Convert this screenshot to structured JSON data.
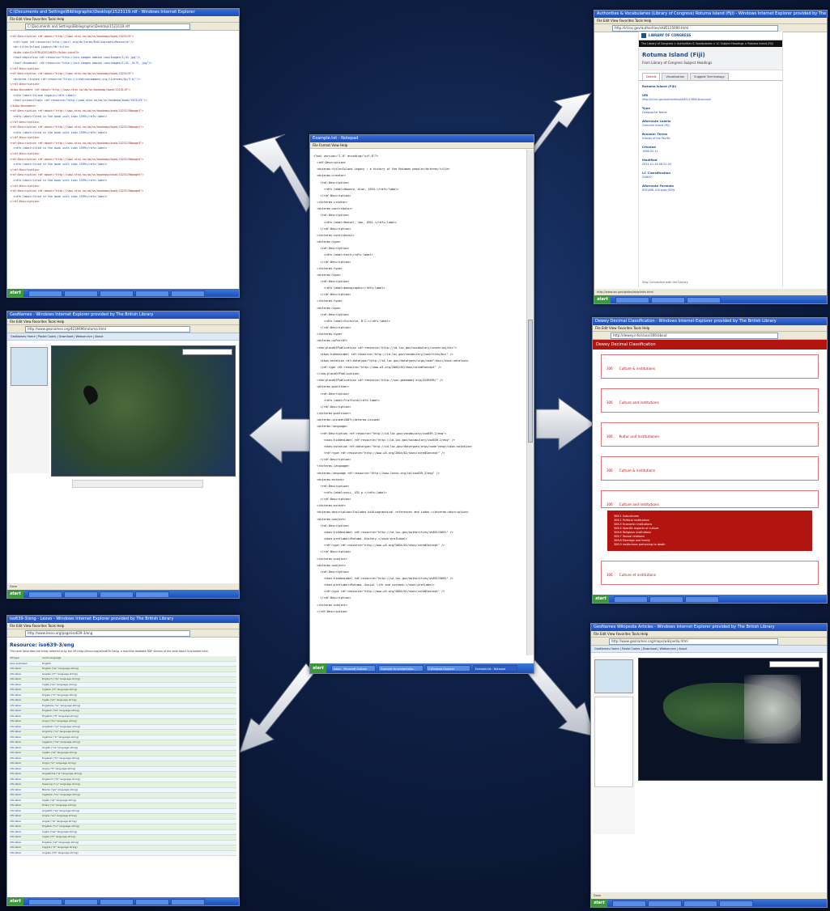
{
  "center": {
    "title": "Example.txt - Notepad",
    "menu": "File  Format  View  Help",
    "lines": [
      "<?xml version=\"1.0\" encoding=\"utf-8\"?>",
      "  <rdf:Description>",
      "  <dcterms:title>Island Legacy : a history of the Rotuman people</dcterms:title>",
      "  <dcterms:creator>",
      "    <rdf:Description>",
      "      <rdfs:label>Howard, Alan, 1934-</rdfs:label>",
      "    </rdf:Description>",
      "  </dcterms:creator>",
      "  <dcterms:contributor>",
      "    <rdf:Description>",
      "      <rdfs:label>Rensel, Jan, 1951-</rdfs:label>",
      "    </rdf:Description>",
      "  </dcterms:contributor>",
      "  <dcterms:type>",
      "    <rdf:Description>",
      "      <rdfs:label>text</rdfs:label>",
      "    </rdf:Description>",
      "  </dcterms:type>",
      "  <dcterms:type>",
      "    <rdf:Description>",
      "      <rdfs:label>monographic</rdfs:label>",
      "    </rdf:Description>",
      "  </dcterms:type>",
      "  <dcterms:type>",
      "    <rdf:Description>",
      "      <rdfs:label>Victoria, B.C.</rdfs:label>",
      "    </rdf:Description>",
      "  </dcterms:type>",
      "  <dcterms:isPartOf>",
      "  <rda:placeOfPublication rdf:resource=\"http://id.loc.gov/vocabulary/countries/bcc\">",
      "    <skos:hiddenLabel rdf:resource=\"http://id.loc.gov/vocabulary/countries/bcc\" />",
      "    <skos:notation rdf:datatype=\"http://id.loc.gov/datatypes/orgs/code\">bcc</skos:notation>",
      "    <rdf:type rdf:resource=\"http://www.w3.org/2004/02/skos/core#Concept\" />",
      "  </rda:placeOfPublication>",
      "  <rda:placeOfPublication rdf:resource=\"http://sws.geonames.org/4239496/\" />",
      "  <dcterms:publisher>",
      "    <rdf:Description>",
      "      <rdfs:label>Trafford</rdfs:label>",
      "    </rdf:Description>",
      "  </dcterms:publisher>",
      "  <dcterms:issued>2007</dcterms:issued>",
      "  <dcterms:language>",
      "    <rdf:Description rdf:resource=\"http://id.loc.gov/vocabulary/iso639-2/eng\">",
      "      <skos:hiddenLabel rdf:resource=\"http://id.loc.gov/vocabulary/iso639-2/eng\" />",
      "      <skos:notation rdf:datatype=\"http://id.loc.gov/datatypes/orgs/code\">eng</skos:notation>",
      "      <rdf:type rdf:resource=\"http://www.w3.org/2004/02/skos/core#Concept\" />",
      "    </rdf:Description>",
      "  </dcterms:language>",
      "  <dcterms:language rdf:resource=\"http://www.lexvo.org/id/iso639-3/eng\" />",
      "  <dcterms:extent>",
      "    <rdf:Description>",
      "      <rdfs:label>xxvi, 432 p.</rdfs:label>",
      "    </rdf:Description>",
      "  </dcterms:extent>",
      "  <dcterms:description>Includes bibliographical references and index.</dcterms:description>",
      "  <dcterms:subject>",
      "    <rdf:Description>",
      "      <skos:hiddenLabel rdf:resource=\"http://id.loc.gov/authorities/sh85115691\" />",
      "      <skos:prefLabel>Rotuma--History.</skos:prefLabel>",
      "      <rdf:type rdf:resource=\"http://www.w3.org/2004/02/skos/core#Concept\" />",
      "    </rdf:Description>",
      "  </dcterms:subject>",
      "  <dcterms:subject>",
      "    <rdf:Description>",
      "      <skos:hiddenLabel rdf:resource=\"http://id.loc.gov/authorities/sh85115692\" />",
      "      <skos:prefLabel>Rotuma--Social life and customs.</skos:prefLabel>",
      "      <rdf:type rdf:resource=\"http://www.w3.org/2004/02/skos/core#Concept\" />",
      "    </rdf:Description>",
      "  </dcterms:subject>",
      "  </rdf:Description>"
    ],
    "taskbar": [
      "Inbox - Microsoft Outlook",
      "Example for presentatio...",
      "3 Windows Explorer",
      "Example.txt - Notepad"
    ]
  },
  "top_left": {
    "title": "C:\\Documents and Settings\\Bibliographic\\Desktop\\1523119.rdf - Windows Internet Explorer",
    "menu": "File  Edit  View  Favorites  Tools  Help",
    "address": "C:\\Documents and Settings\\Bibliographic\\Desktop\\1523119.rdf",
    "lines": [
      "<rdf:Description rdf:about=\"http://www.ntnu.no/ub/sn/bookmap/book/1523119\">",
      "  <rdf:type rdf:resource=\"http://purl.org/dc/terms/BibliographicResource\"/>",
      "  <dc:title>Island Legacy</dc:title>",
      "  <bibo:isbn13>9781425124632</bibo:isbn13>",
      "  <foaf:depiction rdf:resource=\"http://ecx.images-amazon.com/images/I/41.jpg\"/>",
      "  <foaf:thumbnail rdf:resource=\"http://ecx.images-amazon.com/images/I/41._SL75_.jpg\"/>",
      "</rdf:Description>",
      "<rdf:Description rdf:about=\"http://www.ntnu.no/ub/sn/bookmap/book/1523119\">",
      "  <dcterms:license rdf:resource=\"http://creativecommons.org/licenses/by/3.0/\"/>",
      "</rdf:Description>",
      "<bibo:Document rdf:about=\"http://www.ntnu.no/ub/sn/bookmap/book/1523119\">",
      "  <rdfs:label>Island Legacy</rdfs:label>",
      "  <foaf:primaryTopic rdf:resource=\"http://www.ntnu.no/ub/sn/bookmap/book/1523119\"/>",
      "</bibo:Document>",
      "<rdf:Description rdf:about=\"http://www.ntnu.no/ub/sn/bookmap/book/1523119#page1\">",
      "  <rdfs:label>Cited in the book with isbn 1599</rdfs:label>",
      "</rdf:Description>",
      "<rdf:Description rdf:about=\"http://www.ntnu.no/ub/sn/bookmap/book/1523119#page2\">",
      "  <rdfs:label>Cited in the book with isbn 1599</rdfs:label>",
      "</rdf:Description>",
      "<rdf:Description rdf:about=\"http://www.ntnu.no/ub/sn/bookmap/book/1523119#page3\">",
      "  <rdfs:label>Cited in the book with isbn 1599</rdfs:label>",
      "</rdf:Description>",
      "<rdf:Description rdf:about=\"http://www.ntnu.no/ub/sn/bookmap/book/1523119#page4\">",
      "  <rdfs:label>Cited in the book with isbn 1599</rdfs:label>",
      "</rdf:Description>",
      "<rdf:Description rdf:about=\"http://www.ntnu.no/ub/sn/bookmap/book/1523119#page5\">",
      "  <rdfs:label>Cited in the book with isbn 1599</rdfs:label>",
      "</rdf:Description>",
      "<rdf:Description rdf:about=\"http://www.ntnu.no/ub/sn/bookmap/book/1523119#page6\">",
      "  <rdfs:label>Cited in the book with isbn 1599</rdfs:label>",
      "</rdf:Description>"
    ]
  },
  "top_right": {
    "title": "Authorities & Vocabularies (Library of Congress) Rotuma Island (Fiji) - Windows Internet Explorer provided by The British Library",
    "menu": "File  Edit  View  Favorites  Tools  Help",
    "address": "http://id.loc.gov/authorities/sh85115690.html",
    "site_name": "LIBRARY OF CONGRESS",
    "breadcrumb": "The Library of Congress > Authorities & Vocabularies > LC Subject Headings > Rotuma Island (Fiji)",
    "heading": "Rotuma Island (Fiji)",
    "subheading": "From Library of Congress Subject Headings",
    "tabs": [
      "Details",
      "Visualization",
      "Suggest Terminology"
    ],
    "fields": [
      {
        "label": "Rotuma Island (Fiji)",
        "value": ""
      },
      {
        "label": "URI",
        "value": "http://id.loc.gov/authorities/sh85115690#concept"
      },
      {
        "label": "Type",
        "value": "Geographic Name"
      },
      {
        "label": "Alternate Labels",
        "value": "Grenville Island (Fiji)"
      },
      {
        "label": "Broader Terms",
        "value": "Islands of the Pacific"
      },
      {
        "label": "Created",
        "value": "1986-02-11"
      },
      {
        "label": "Modified",
        "value": "2011-01-26 08:52:03"
      },
      {
        "label": "LC Classification",
        "value": "DU600"
      },
      {
        "label": "Alternate Formats",
        "value": "RDF/XML  N-Triples  JSON"
      }
    ],
    "footer": "Stay Connected with the Library",
    "status": "http://www.loc.gov/global/skiplinks.html"
  },
  "mid_left": {
    "title": "GeoNames - Windows Internet Explorer provided by The British Library",
    "menu": "File  Edit  View  Favorites  Tools  Help",
    "address": "http://www.geonames.org/4239496/rotuma.html",
    "nav": "GeoNames Home | Postal Codes | Download | Webservice | About",
    "status": "Done"
  },
  "mid_right": {
    "title": "Dewey Decimal Classification - Windows Internet Explorer provided by The British Library",
    "menu": "File  Edit  View  Favorites  Tools  Help",
    "address": "http://dewey.info/class/306/about",
    "banner": "Dewey Decimal Classification",
    "entries": [
      {
        "code": "306",
        "label": "Culture & institutions"
      },
      {
        "code": "306",
        "label": "Culture and institutions"
      },
      {
        "code": "306",
        "label": "Kultur und Institutionen"
      },
      {
        "code": "306",
        "label": "Culture & institutions"
      },
      {
        "code": "306",
        "label": "Culture and institutions"
      },
      {
        "code": "306",
        "label": "Culture et institutions"
      }
    ],
    "subclasses": [
      "306.1  Subcultures",
      "306.2  Political institutions",
      "306.3  Economic institutions",
      "306.4  Specific aspects of culture",
      "306.6  Religious institutions",
      "306.7  Sexual relations",
      "306.8  Marriage and family",
      "306.9  Institutions pertaining to death"
    ]
  },
  "bottom_left": {
    "title": "iso639-3/eng - Lexvo - Windows Internet Explorer provided by The British Library",
    "menu": "File  Edit  View  Favorites  Tools  Help",
    "address": "http://www.lexvo.org/page/iso639-3/eng",
    "heading": "Resource: iso639-3/eng",
    "intro": "This term describes the entity referred to by the URI http://lexvo.org/id/iso639-3/eng, a machine-readable RDF version of the view about is provided here.",
    "rows": [
      [
        "rdf:type",
        "lvont:Language"
      ],
      [
        "skos:prefLabel",
        "English"
      ],
      [
        "rdfs:label",
        "English (\"en\" language string)"
      ],
      [
        "rdfs:label",
        "Anglais (\"fr\" language string)"
      ],
      [
        "rdfs:label",
        "Englisch (\"de\" language string)"
      ],
      [
        "rdfs:label",
        "Inglés (\"es\" language string)"
      ],
      [
        "rdfs:label",
        "Inglese (\"it\" language string)"
      ],
      [
        "rdfs:label",
        "Engels (\"nl\" language string)"
      ],
      [
        "rdfs:label",
        "Inglês (\"pt\" language string)"
      ],
      [
        "rdfs:label",
        "Engelska (\"sv\" language string)"
      ],
      [
        "rdfs:label",
        "Engelsk (\"da\" language string)"
      ],
      [
        "rdfs:label",
        "Englanti (\"fi\" language string)"
      ],
      [
        "rdfs:label",
        "Angol (\"hu\" language string)"
      ],
      [
        "rdfs:label",
        "Angielski (\"pl\" language string)"
      ],
      [
        "rdfs:label",
        "Anglický (\"cs\" language string)"
      ],
      [
        "rdfs:label",
        "İngilizce (\"tr\" language string)"
      ],
      [
        "rdfs:label",
        "Inggeris (\"ms\" language string)"
      ],
      [
        "rdfs:label",
        "Anglès (\"ca\" language string)"
      ],
      [
        "rdfs:label",
        "Ingalls (\"et\" language string)"
      ],
      [
        "rdfs:label",
        "Engleski (\"hr\" language string)"
      ],
      [
        "rdfs:label",
        "Angļu (\"lv\" language string)"
      ],
      [
        "rdfs:label",
        "Anglų (\"lt\" language string)"
      ],
      [
        "rdfs:label",
        "Angleščina (\"sl\" language string)"
      ],
      [
        "rdfs:label",
        "Englesch (\"lb\" language string)"
      ],
      [
        "rdfs:label",
        "Saesneg (\"cy\" language string)"
      ],
      [
        "rdfs:label",
        "Béarla (\"ga\" language string)"
      ],
      [
        "rdfs:label",
        "Ingelesa (\"eu\" language string)"
      ],
      [
        "rdfs:label",
        "Inglés (\"gl\" language string)"
      ],
      [
        "rdfs:label",
        "Enska (\"is\" language string)"
      ],
      [
        "rdfs:label",
        "Anglisht (\"sq\" language string)"
      ],
      [
        "rdfs:label",
        "Angla (\"eo\" language string)"
      ],
      [
        "rdfs:label",
        "Anglia (\"la\" language string)"
      ],
      [
        "rdfs:label",
        "Englesk (\"no\" language string)"
      ],
      [
        "rdfs:label",
        "Inglisi (\"sw\" language string)"
      ],
      [
        "rdfs:label",
        "Ingles (\"tl\" language string)"
      ],
      [
        "rdfs:label",
        "Engelse (\"af\" language string)"
      ],
      [
        "rdfs:label",
        "Inggris (\"id\" language string)"
      ],
      [
        "rdfs:label",
        "Anglais (\"ht\" language string)"
      ]
    ]
  },
  "bottom_right": {
    "title": "GeoNames Wikipedia Articles - Windows Internet Explorer provided by The British Library",
    "menu": "File  Edit  View  Favorites  Tools  Help",
    "address": "http://www.geonames.org/maps/wikipedia.html",
    "nav": "GeoNames Home | Postal Codes | Download | Webservice | About",
    "status": "Done"
  },
  "colors": {
    "background": "#0e1f44",
    "arrow_fill": "#dfe3ea",
    "dewey_red": "#b2140f",
    "loc_blue": "#1f4f8f",
    "xml_blue": "#1a3fa8",
    "xml_red": "#a01818"
  }
}
